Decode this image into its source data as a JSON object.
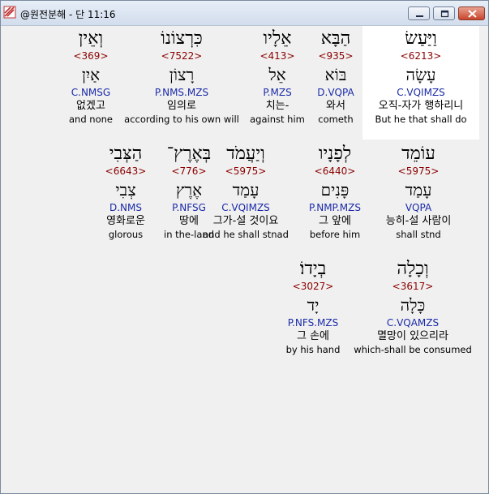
{
  "window": {
    "title": "@원전분해 - 단 11:16"
  },
  "rows": [
    [
      {
        "heb": "וַיַּעַשׂ",
        "strong": "<6213>",
        "lemma": "עָשָׂה",
        "morph": "C.VQIMZS",
        "kor": "오직-자가 행하리니",
        "eng": "But he that shall do",
        "highlight": true
      },
      {
        "heb": "הַבָּא",
        "strong": "<935>",
        "lemma": "בּוֹא",
        "morph": "D.VQPA",
        "kor": "와서",
        "eng": "cometh"
      },
      {
        "heb": "אֵלָיו",
        "strong": "<413>",
        "lemma": "אֵל",
        "morph": "P.MZS",
        "kor": "치는-",
        "eng": "against him"
      },
      {
        "heb": "כִּרְצוֹנוֹ",
        "strong": "<7522>",
        "lemma": "רָצוֹן",
        "morph": "P.NMS.MZS",
        "kor": "임의로",
        "eng": "according to his own will"
      },
      {
        "heb": "וְאֵין",
        "strong": "<369>",
        "lemma": "אַיִן",
        "morph": "C.NMSG",
        "kor": "없겠고",
        "eng": "and none"
      }
    ],
    [
      {
        "heb": "עוֹמֵד",
        "strong": "<5975>",
        "lemma": "עָמַד",
        "morph": "VQPA",
        "kor": "능히-설 사람이",
        "eng": "shall stnd"
      },
      {
        "heb": "לְפָנָיו",
        "strong": "<6440>",
        "lemma": "פָּנִים",
        "morph": "P.NMP.MZS",
        "kor": "그 앞에",
        "eng": "before him"
      },
      {
        "heb": "וְיַעֲמֹד",
        "strong": "<5975>",
        "lemma": "עָמַד",
        "morph": "C.VQIMZS",
        "kor": "그가-설 것이요",
        "eng": "and he shall stnad"
      },
      {
        "heb": "בְּאֶרֶץ־",
        "strong": "<776>",
        "lemma": "אֶרֶץ",
        "morph": "P.NFSG",
        "kor": "땅에",
        "eng": "in the-land"
      },
      {
        "heb": "הַצְּבִי",
        "strong": "<6643>",
        "lemma": "צְבִי",
        "morph": "D.NMS",
        "kor": "영화로운",
        "eng": "glorous"
      }
    ],
    [
      {
        "heb": "וְכָלָה",
        "strong": "<3617>",
        "lemma": "כָּלָה",
        "morph": "C.VQAMZS",
        "kor": "멸망이 있으리라",
        "eng": "which-shall be consumed"
      },
      {
        "heb": "בְיָדוֹ׃",
        "strong": "<3027>",
        "lemma": "יָד",
        "morph": "P.NFS.MZS",
        "kor": "그 손에",
        "eng": "by his hand"
      }
    ]
  ]
}
